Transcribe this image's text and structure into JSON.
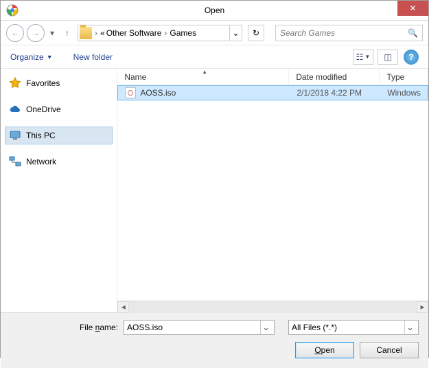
{
  "window": {
    "title": "Open"
  },
  "nav": {
    "breadcrumb_prefix": "«",
    "breadcrumb_1": "Other Software",
    "breadcrumb_2": "Games",
    "search_placeholder": "Search Games"
  },
  "toolbar": {
    "organize": "Organize",
    "new_folder": "New folder"
  },
  "sidebar": {
    "favorites": "Favorites",
    "onedrive": "OneDrive",
    "this_pc": "This PC",
    "network": "Network"
  },
  "columns": {
    "name": "Name",
    "date": "Date modified",
    "type": "Type"
  },
  "files": [
    {
      "name": "AOSS.iso",
      "date": "2/1/2018 4:22 PM",
      "type": "Windows"
    }
  ],
  "footer": {
    "filename_label": "File name:",
    "filename_value": "AOSS.iso",
    "filter_value": "All Files (*.*)",
    "open": "Open",
    "cancel": "Cancel"
  }
}
